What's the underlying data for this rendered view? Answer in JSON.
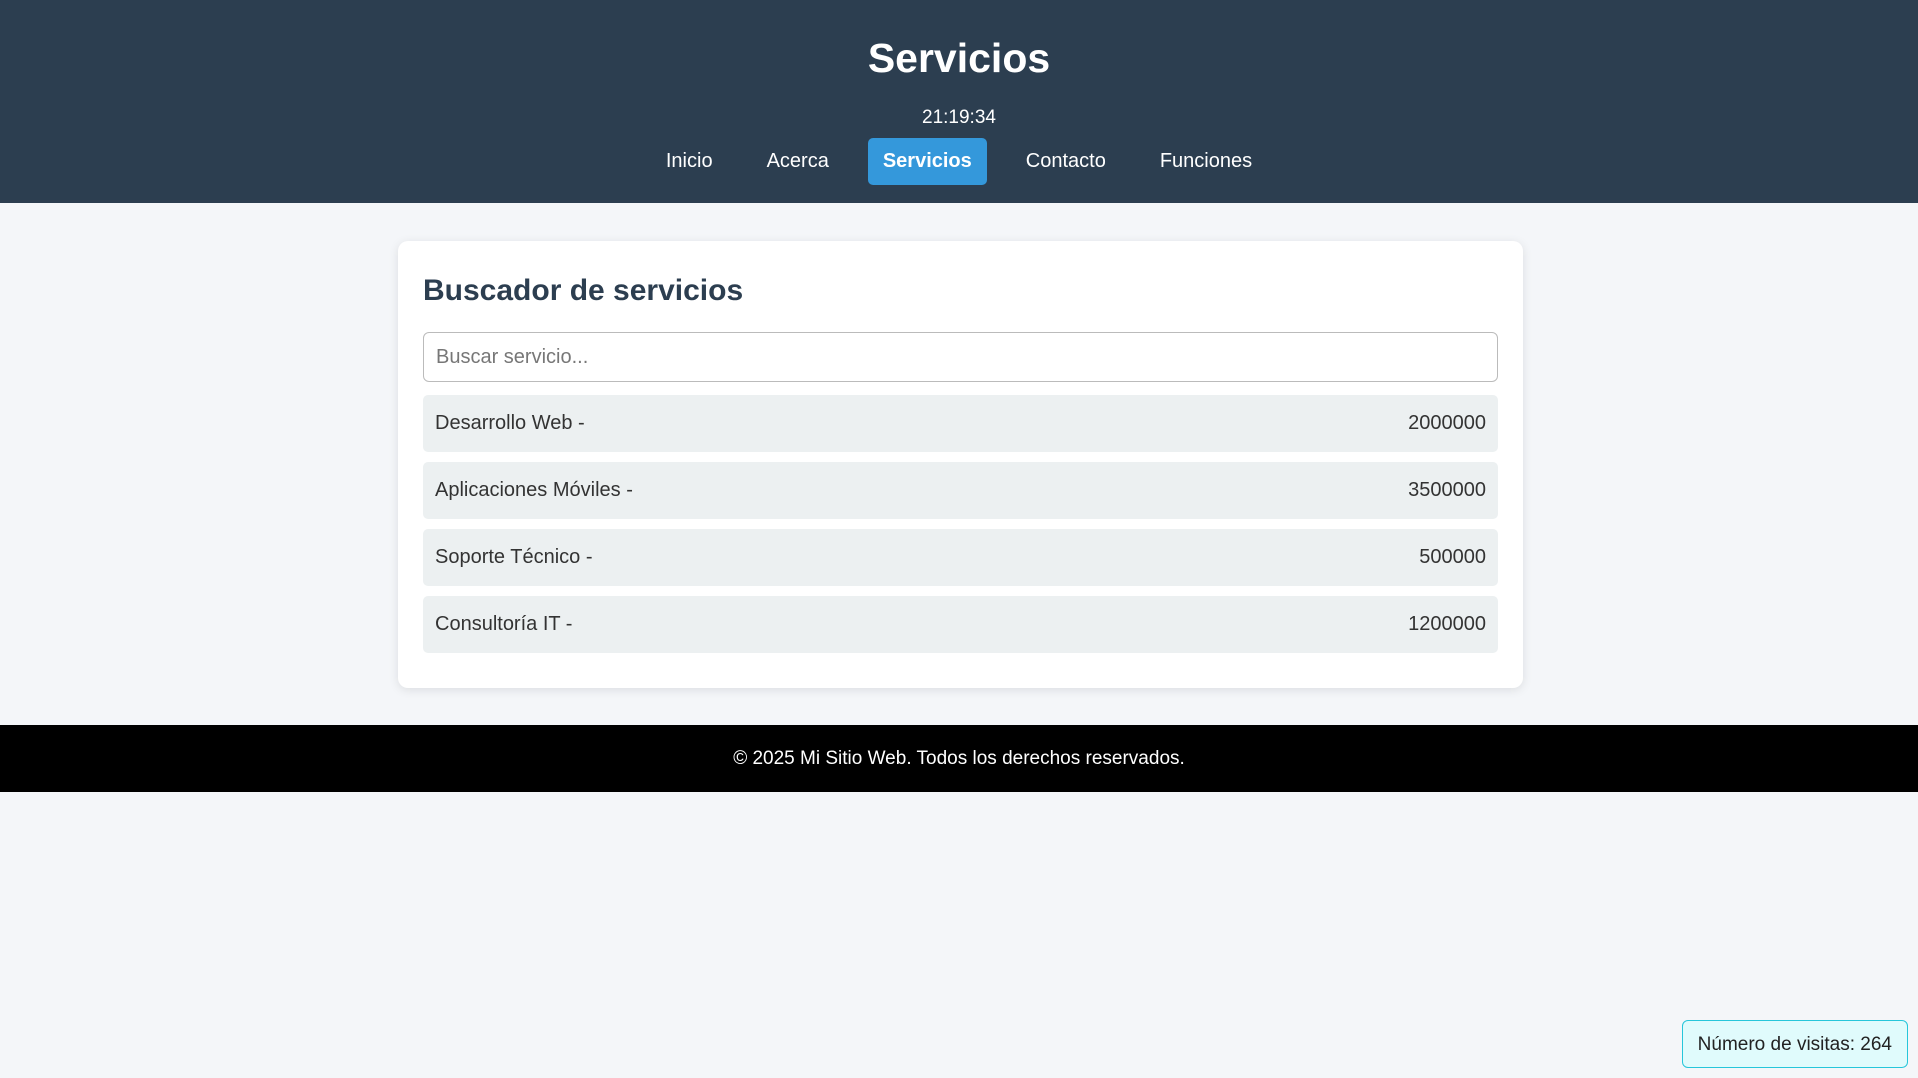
{
  "header": {
    "title": "Servicios",
    "clock": "21:19:34",
    "nav": [
      {
        "label": "Inicio",
        "active": false
      },
      {
        "label": "Acerca",
        "active": false
      },
      {
        "label": "Servicios",
        "active": true
      },
      {
        "label": "Contacto",
        "active": false
      },
      {
        "label": "Funciones",
        "active": false
      }
    ]
  },
  "main": {
    "title": "Buscador de servicios",
    "search_placeholder": "Buscar servicio...",
    "search_value": "",
    "services": [
      {
        "name": "Desarrollo Web -",
        "price": "2000000"
      },
      {
        "name": "Aplicaciones Móviles -",
        "price": "3500000"
      },
      {
        "name": "Soporte Técnico -",
        "price": "500000"
      },
      {
        "name": "Consultoría IT -",
        "price": "1200000"
      }
    ]
  },
  "footer": {
    "text": "© 2025 Mi Sitio Web. Todos los derechos reservados."
  },
  "visits": {
    "text": "Número de visitas: 264"
  },
  "colors": {
    "header_bg": "#2c3e50",
    "accent": "#3498db",
    "page_bg": "#f4f6f9",
    "item_bg": "#ecf0f1",
    "footer_bg": "#000000",
    "counter_bg": "#e0fbfc",
    "counter_border": "#26c6da"
  }
}
